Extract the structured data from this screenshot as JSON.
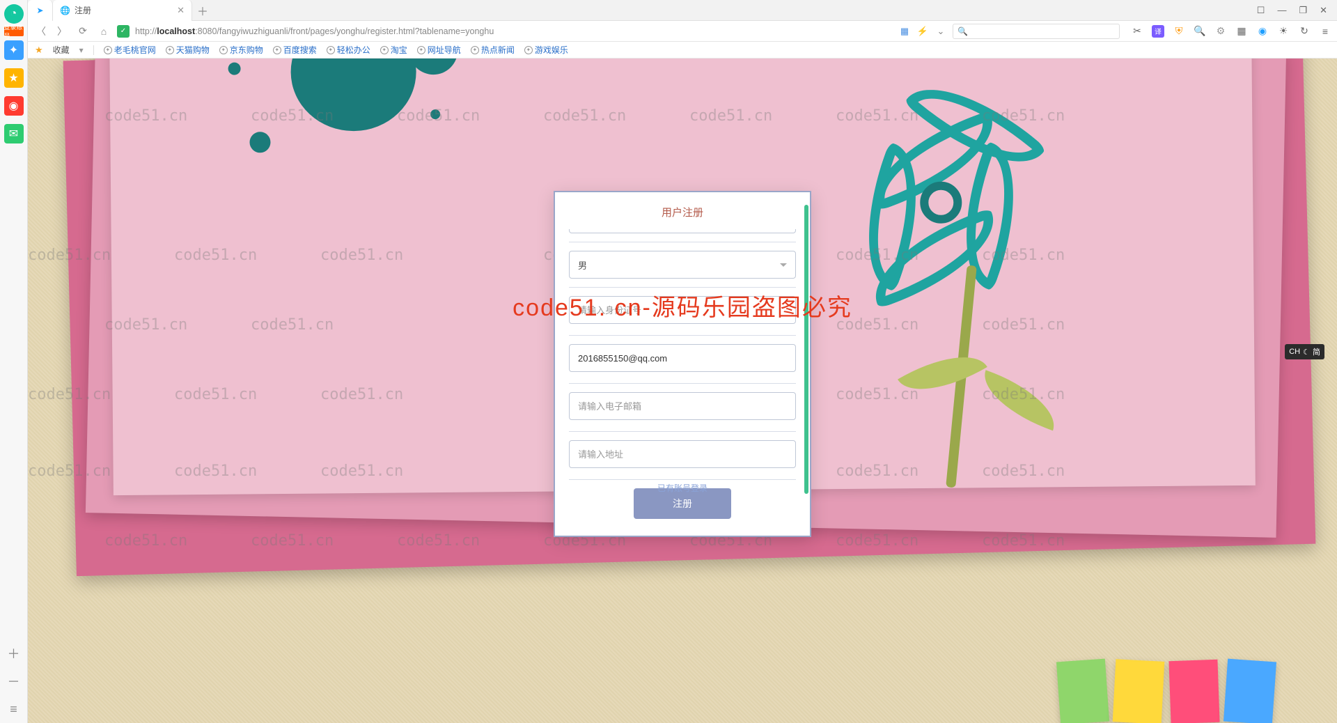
{
  "sidebar": {
    "badge": "登录账号"
  },
  "tab": {
    "title": "注册"
  },
  "window": {
    "controls": [
      "☐",
      "—",
      "❐",
      "✕"
    ]
  },
  "addr": {
    "url_prefix": "http://",
    "url_host": "localhost",
    "url_rest": ":8080/fangyiwuzhiguanli/front/pages/yonghu/register.html?tablename=yonghu"
  },
  "bookmarks": {
    "fav": "收藏",
    "items": [
      "老毛桃官网",
      "天猫购物",
      "京东购物",
      "百度搜索",
      "轻松办公",
      "淘宝",
      "网址导航",
      "热点新闻",
      "游戏娱乐"
    ]
  },
  "form": {
    "title": "用户注册",
    "gender": "男",
    "id_placeholder": "请输入身份证号",
    "qq_value": "2016855150@qq.com",
    "email_placeholder": "请输入电子邮箱",
    "addr_placeholder": "请输入地址",
    "submit": "注册",
    "login_link": "已有账号登录"
  },
  "watermark": {
    "text": "code51.cn",
    "big": "code51. cn-源码乐园盗图必究"
  },
  "ime": {
    "label": "CH",
    "mode": "简"
  }
}
